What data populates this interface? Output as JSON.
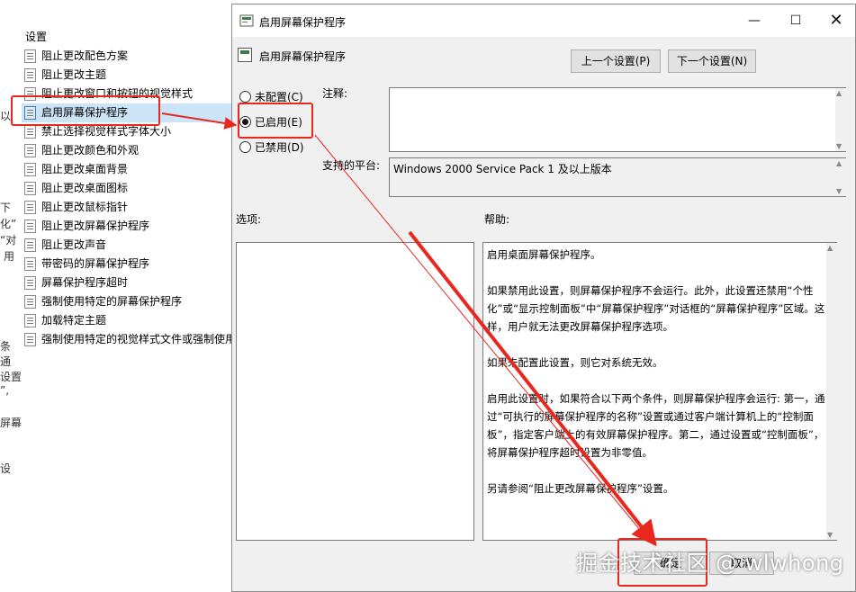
{
  "background": {
    "header": "设置",
    "items": [
      "阻止更改配色方案",
      "阻止更改主题",
      "阻止更改窗口和按钮的视觉样式",
      "启用屏幕保护程序",
      "禁止选择视觉样式字体大小",
      "阻止更改颜色和外观",
      "阻止更改桌面背景",
      "阻止更改桌面图标",
      "阻止更改鼠标指针",
      "阻止更改屏幕保护程序",
      "阻止更改声音",
      "带密码的屏幕保护程序",
      "屏幕保护程序超时",
      "强制使用特定的屏幕保护程序",
      "加载特定主题",
      "强制使用特定的视觉样式文件或强制使用"
    ],
    "selected_index": 3,
    "edge_fragments": [
      "以",
      "下",
      "化”",
      "“对",
      "用",
      "条",
      "通",
      "设置",
      "”,",
      "屏幕",
      "设"
    ]
  },
  "dialog": {
    "title": "启用屏幕保护程序",
    "window_buttons": {
      "minimize": "—",
      "maximize": "☐",
      "close": "✕"
    },
    "policy_name": "启用屏幕保护程序",
    "prev_button": "上一个设置(P)",
    "next_button": "下一个设置(N)",
    "radios": {
      "not_configured": "未配置(C)",
      "enabled": "已启用(E)",
      "disabled": "已禁用(D)",
      "selected": "enabled"
    },
    "comment_label": "注释:",
    "comment_value": "",
    "platform_label": "支持的平台:",
    "platform_value": "Windows 2000 Service Pack 1 及以上版本",
    "options_label": "选项:",
    "help_label": "帮助:",
    "help_paragraphs": [
      "启用桌面屏幕保护程序。",
      "如果禁用此设置，则屏幕保护程序不会运行。此外，此设置还禁用“个性化”或“显示控制面板”中“屏幕保护程序”对话框的“屏幕保护程序”区域。这样，用户就无法更改屏幕保护程序选项。",
      "如果未配置此设置，则它对系统无效。",
      "启用此设置时，如果符合以下两个条件，则屏幕保护程序会运行: 第一，通过“可执行的屏幕保护程序的名称”设置或通过客户端计算机上的“控制面板”，指定客户端上的有效屏幕保护程序。第二，通过设置或“控制面板”，将屏幕保护程序超时设置为非零值。",
      "另请参阅“阻止更改屏幕保护程序”设置。"
    ],
    "ok_button": "确定",
    "cancel_button": "取消"
  },
  "annotation_color": "#e8281e",
  "watermark": "掘金技术社区 @ wlwhong"
}
